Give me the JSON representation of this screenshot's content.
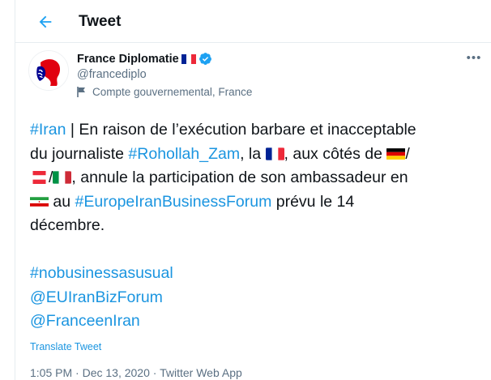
{
  "header": {
    "title": "Tweet",
    "back_icon": "arrow-left-icon"
  },
  "author": {
    "display_name": "France Diplomatie",
    "handle": "@francediplo",
    "verified": true,
    "label": "Compte gouvernemental, France"
  },
  "tweet": {
    "lines": [
      [
        {
          "text": "#Iran",
          "type": "link"
        },
        {
          "text": " | En raison de l’exécution barbare et inacceptable",
          "type": "text"
        }
      ],
      [
        {
          "text": "du journaliste ",
          "type": "text"
        },
        {
          "text": "#Rohollah_Zam",
          "type": "link"
        },
        {
          "text": ", la ",
          "type": "text"
        },
        {
          "flag": "fr",
          "type": "flag"
        },
        {
          "text": ", aux côtés de ",
          "type": "text"
        },
        {
          "flag": "de",
          "type": "flag"
        },
        {
          "text": "/",
          "type": "text"
        }
      ],
      [
        {
          "flag": "at",
          "type": "flag"
        },
        {
          "text": "/",
          "type": "text"
        },
        {
          "flag": "it",
          "type": "flag"
        },
        {
          "text": ", annule la participation de son ambassadeur en",
          "type": "text"
        }
      ],
      [
        {
          "flag": "ir",
          "type": "flag"
        },
        {
          "text": " au ",
          "type": "text"
        },
        {
          "text": "#EuropeIranBusinessForum",
          "type": "link"
        },
        {
          "text": " prévu le 14",
          "type": "text"
        }
      ],
      [
        {
          "text": "décembre.",
          "type": "text"
        }
      ],
      [],
      [
        {
          "text": "#nobusinessasusual",
          "type": "link"
        }
      ],
      [
        {
          "text": "@EUIranBizForum",
          "type": "link"
        }
      ],
      [
        {
          "text": "@FranceenIran",
          "type": "link"
        }
      ]
    ]
  },
  "translate_label": "Translate Tweet",
  "meta": {
    "time": "1:05 PM",
    "date": "Dec 13, 2020",
    "source": "Twitter Web App",
    "separator": "·"
  },
  "colors": {
    "link": "#1b95e0",
    "secondary_text": "#5b7083",
    "verified": "#1da1f2",
    "border": "#e6ecf0"
  }
}
